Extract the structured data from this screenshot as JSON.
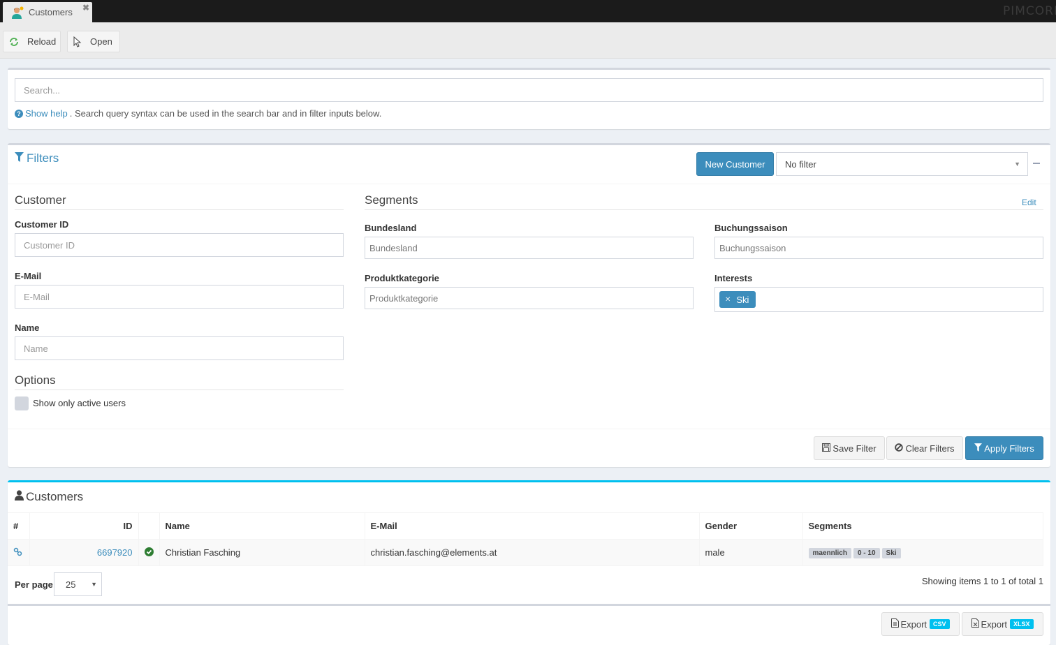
{
  "window": {
    "tab_label": "Customers",
    "brand": "PIMCORE"
  },
  "toolbar": {
    "reload_label": "Reload",
    "open_label": "Open"
  },
  "search": {
    "placeholder": "Search...",
    "value": "",
    "help_link": "Show help",
    "help_text": ". Search query syntax can be used in the search bar and in filter inputs below."
  },
  "filters": {
    "title": "Filters",
    "new_customer_label": "New Customer",
    "filter_select_value": "No filter",
    "customer_section": {
      "title": "Customer",
      "fields": [
        {
          "label": "Customer ID",
          "placeholder": "Customer ID",
          "value": ""
        },
        {
          "label": "E-Mail",
          "placeholder": "E-Mail",
          "value": ""
        },
        {
          "label": "Name",
          "placeholder": "Name",
          "value": ""
        }
      ]
    },
    "options_section": {
      "title": "Options",
      "active_users_label": "Show only active users",
      "active_users_checked": false
    },
    "segments_section": {
      "title": "Segments",
      "edit_label": "Edit",
      "fields": [
        {
          "label": "Bundesland",
          "placeholder": "Bundesland",
          "value": ""
        },
        {
          "label": "Buchungssaison",
          "placeholder": "Buchungssaison",
          "value": ""
        },
        {
          "label": "Produktkategorie",
          "placeholder": "Produktkategorie",
          "value": ""
        },
        {
          "label": "Interests",
          "selected_tags": [
            "Ski"
          ]
        }
      ]
    },
    "save_filter_label": "Save Filter",
    "clear_filters_label": "Clear Filters",
    "apply_filters_label": "Apply Filters"
  },
  "customers": {
    "title": "Customers",
    "columns": [
      "#",
      "ID",
      "",
      "Name",
      "E-Mail",
      "Gender",
      "Segments"
    ],
    "rows": [
      {
        "id": "6697920",
        "active": true,
        "name": "Christian Fasching",
        "email": "christian.fasching@elements.at",
        "gender": "male",
        "segments": [
          "maennlich",
          "0 - 10",
          "Ski"
        ]
      }
    ],
    "per_page_label": "Per page",
    "per_page_value": "25",
    "showing_text": "Showing items 1 to 1 of total 1",
    "export_label": "Export",
    "export_csv_badge": "CSV",
    "export_xlsx_badge": "XLSX"
  },
  "colors": {
    "accent": "#3c8dbc",
    "info": "#00c0ef",
    "success": "#2e7d32"
  }
}
